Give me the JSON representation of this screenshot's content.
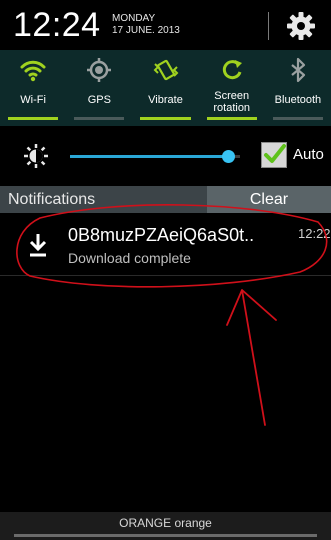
{
  "status": {
    "time": "12:24",
    "day": "MONDAY",
    "date": "17 JUNE. 2013"
  },
  "quick_settings": [
    {
      "label": "Wi-Fi",
      "icon": "wifi-icon",
      "on": true
    },
    {
      "label": "GPS",
      "icon": "gps-icon",
      "on": false
    },
    {
      "label": "Vibrate",
      "icon": "vibrate-icon",
      "on": true
    },
    {
      "label": "Screen rotation",
      "line1": "Screen",
      "line2": "rotation",
      "icon": "screen-rotation-icon",
      "on": true
    },
    {
      "label": "Bluetooth",
      "icon": "bluetooth-icon",
      "on": false
    }
  ],
  "brightness": {
    "level": 0.93,
    "auto_label": "Auto",
    "auto_checked": true
  },
  "notifications": {
    "header": "Notifications",
    "clear_label": "Clear",
    "items": [
      {
        "title": "0B8muzPZAeiQ6aS0t..",
        "time": "12:22",
        "subtitle": "Download complete",
        "icon": "download-icon"
      }
    ]
  },
  "carrier": "ORANGE orange",
  "colors": {
    "accent_green": "#a0d21f",
    "slider_blue": "#38c3f4",
    "annotation_red": "#d0101a"
  }
}
